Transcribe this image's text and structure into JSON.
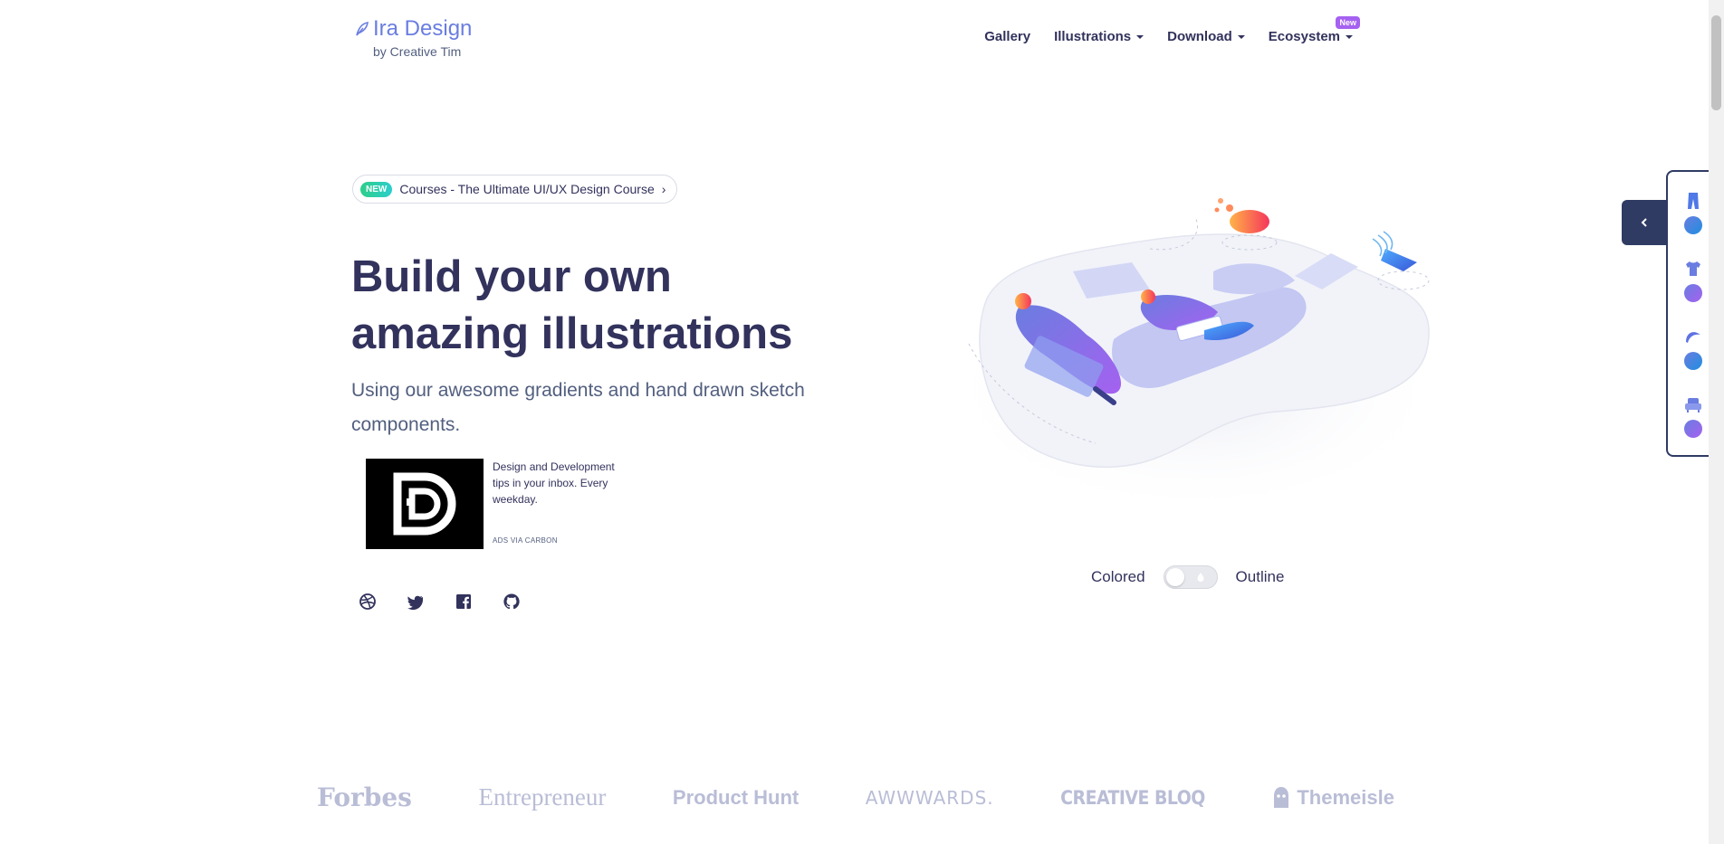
{
  "brand": {
    "title": "Ira Design",
    "subtitle": "by Creative Tim",
    "icon": "feather-icon"
  },
  "nav": {
    "items": [
      {
        "label": "Gallery",
        "dropdown": false
      },
      {
        "label": "Illustrations",
        "dropdown": true
      },
      {
        "label": "Download",
        "dropdown": true
      },
      {
        "label": "Ecosystem",
        "dropdown": true,
        "badge": "New"
      }
    ]
  },
  "promo": {
    "badge": "NEW",
    "text": "Courses - The Ultimate UI/UX Design Course",
    "chevron": "›"
  },
  "hero": {
    "title": "Build your own amazing illustrations",
    "subtitle": "Using our awesome gradients and hand drawn sketch components."
  },
  "ad": {
    "text": "Design and Development tips in your inbox. Every weekday.",
    "via": "ADS VIA CARBON"
  },
  "social": [
    "dribbble-icon",
    "twitter-icon",
    "facebook-icon",
    "github-icon"
  ],
  "toggle": {
    "left_label": "Colored",
    "right_label": "Outline"
  },
  "logos": [
    "Forbes",
    "Entrepreneur",
    "Product Hunt",
    "AWWWARDS.",
    "CREATIVE BLOQ",
    "Themeisle"
  ],
  "colors": {
    "primary": "#32325d",
    "brand": "#6a7de0",
    "new_badge": "#a561f0",
    "promo_badge": "#2dce89",
    "panel": "#2f3b63",
    "logo_gray": "#b9bdd6"
  }
}
